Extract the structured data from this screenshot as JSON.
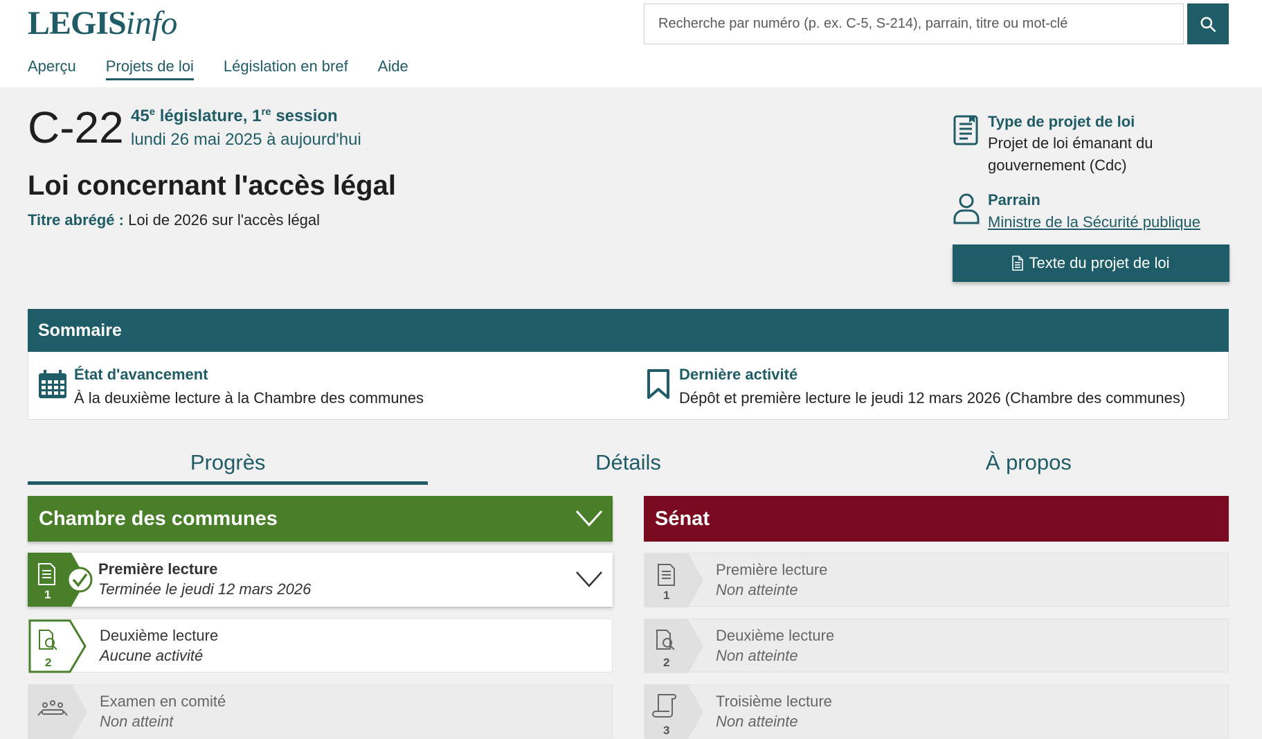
{
  "header": {
    "logo_main": "LEGIS",
    "logo_sub": "info",
    "search_placeholder": "Recherche par numéro (p. ex. C-5, S-214), parrain, titre ou mot-clé",
    "nav": [
      "Aperçu",
      "Projets de loi",
      "Législation en bref",
      "Aide"
    ],
    "active_nav": "Projets de loi"
  },
  "bill": {
    "number": "C-22",
    "legislature_num": "45",
    "legislature_sup": "e",
    "legislature_label": "législature,",
    "session_num": "1",
    "session_sup": "re",
    "session_label": "session",
    "dates": "lundi 26 mai 2025 à aujourd'hui",
    "title": "Loi concernant l'accès légal",
    "short_title_label": "Titre abrégé :",
    "short_title": "Loi de 2026 sur l'accès légal"
  },
  "meta": {
    "type_label": "Type de projet de loi",
    "type_value": "Projet de loi émanant du gouvernement (Cdc)",
    "sponsor_label": "Parrain",
    "sponsor_value": "Ministre de la Sécurité publique",
    "text_button": "Texte du projet de loi"
  },
  "summary": {
    "heading": "Sommaire",
    "status_label": "État d'avancement",
    "status_value": "À la deuxième lecture à la Chambre des communes",
    "last_activity_label": "Dernière activité",
    "last_activity_value": "Dépôt et première lecture le jeudi 12 mars 2026 (Chambre des communes)"
  },
  "tabs": [
    "Progrès",
    "Détails",
    "À propos"
  ],
  "house": {
    "name": "Chambre des communes",
    "stages": [
      {
        "title": "Première lecture",
        "sub": "Terminée le jeudi 12 mars 2026",
        "num": "1",
        "state": "done"
      },
      {
        "title": "Deuxième lecture",
        "sub": "Aucune activité",
        "num": "2",
        "state": "current"
      },
      {
        "title": "Examen en comité",
        "sub": "Non atteint",
        "num": "",
        "state": "pending"
      }
    ]
  },
  "senate": {
    "name": "Sénat",
    "stages": [
      {
        "title": "Première lecture",
        "sub": "Non atteinte",
        "num": "1",
        "state": "pending"
      },
      {
        "title": "Deuxième lecture",
        "sub": "Non atteinte",
        "num": "2",
        "state": "pending"
      },
      {
        "title": "Troisième lecture",
        "sub": "Non atteinte",
        "num": "3",
        "state": "pending"
      }
    ]
  },
  "colors": {
    "teal": "#1e5d68",
    "house_green": "#4a7f2a",
    "senate_red": "#7a0a1f",
    "page_bg": "#f1f1f1"
  }
}
